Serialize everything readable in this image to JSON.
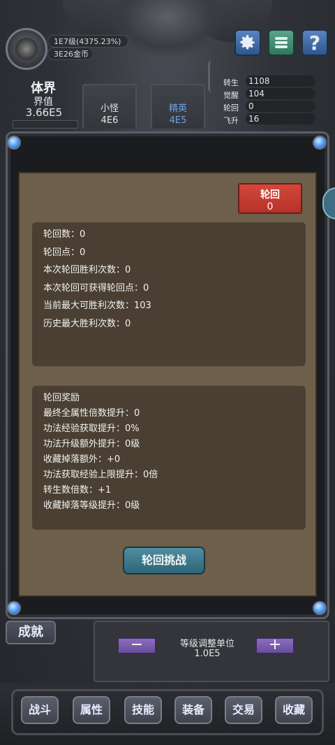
{
  "header": {
    "level_text": "1E7级(4375.23%)",
    "gold_text": "3E26金币",
    "realm_title": "体界",
    "realm_sub": "界值",
    "realm_value": "3.66E5"
  },
  "tabs": [
    {
      "label": "小怪",
      "value": "4E6"
    },
    {
      "label": "精英",
      "value": "4E5"
    }
  ],
  "top_buttons": {
    "help": "?"
  },
  "stats": [
    {
      "label": "转生",
      "value": "1108"
    },
    {
      "label": "觉醒",
      "value": "104"
    },
    {
      "label": "轮回",
      "value": "0"
    },
    {
      "label": "飞升",
      "value": "16"
    }
  ],
  "panel": {
    "reincarnate_button": {
      "label": "轮回",
      "value": "0"
    },
    "info_lines": [
      "轮回数：0",
      "轮回点：0",
      "本次轮回胜利次数：0",
      "本次轮回可获得轮回点：0",
      "当前最大可胜利次数：103",
      "历史最大胜利次数：0"
    ],
    "reward_lines": [
      "轮回奖励",
      "最终全属性倍数提升：0",
      "功法经验获取提升：0%",
      "功法升级额外提升：0级",
      "收藏掉落额外：+0",
      "功法获取经验上限提升：0倍",
      "转生数倍数：+1",
      "收藏掉落等级提升：0级"
    ],
    "challenge_button": "轮回挑战"
  },
  "achievement_button": "成就",
  "adjust": {
    "minus": "−",
    "plus": "+",
    "title": "等级调整单位",
    "value": "1.0E5"
  },
  "nav": [
    "战斗",
    "属性",
    "技能",
    "装备",
    "交易",
    "收藏"
  ],
  "colors": {
    "accent_blue": "#6fa3e8",
    "red_button": "#c43d32",
    "parchment": "#6e5f4b",
    "teal_button": "#3f7a8d",
    "purple_button": "#7b5db0"
  }
}
